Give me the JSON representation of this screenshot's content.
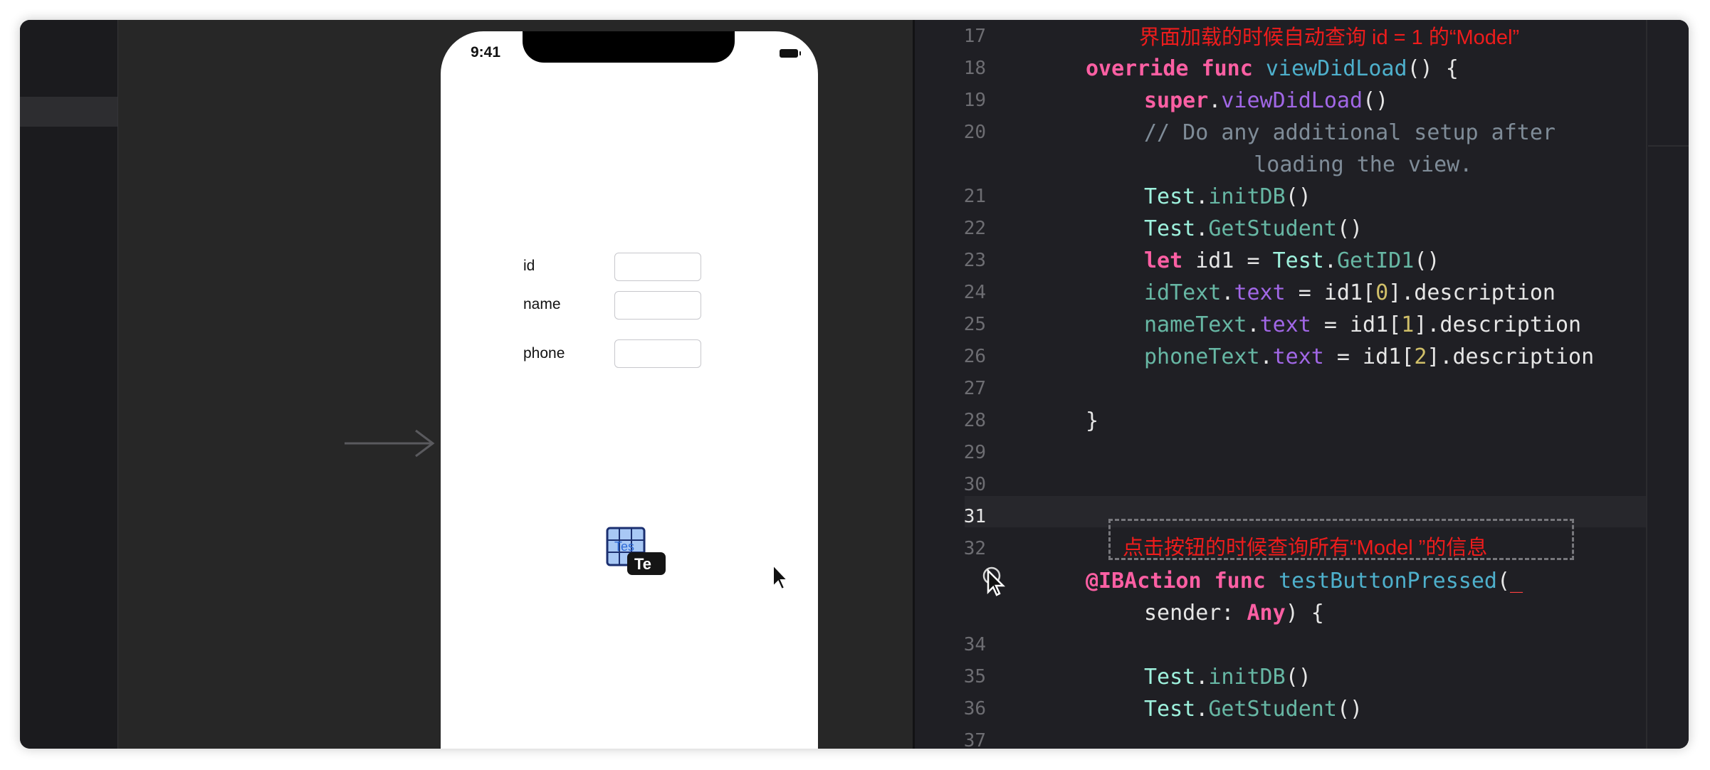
{
  "phone": {
    "status_time": "9:41",
    "fields": [
      {
        "label": "id"
      },
      {
        "label": "name"
      },
      {
        "label": "phone"
      }
    ],
    "drag_ghost_label": "Te",
    "drag_ghost_icon_text": "Tes"
  },
  "editor": {
    "annotation_top": "界面加载的时候自动查询 id = 1 的“Model”",
    "annotation_bottom": "点击按钮的时候查询所有“Model ”的信息",
    "lines": [
      {
        "n": "17",
        "tokens": []
      },
      {
        "n": "18",
        "tokens": [
          {
            "t": "override",
            "c": "kw"
          },
          {
            "t": " "
          },
          {
            "t": "func",
            "c": "kw"
          },
          {
            "t": " "
          },
          {
            "t": "viewDidLoad",
            "c": "fn"
          },
          {
            "t": "() {"
          }
        ]
      },
      {
        "n": "19",
        "tokens": [
          {
            "t": "super",
            "c": "kw"
          },
          {
            "t": "."
          },
          {
            "t": "viewDidLoad",
            "c": "prop"
          },
          {
            "t": "()"
          }
        ]
      },
      {
        "n": "20",
        "tokens": [
          {
            "t": "// Do any additional setup after",
            "c": "cmt"
          }
        ]
      },
      {
        "n": "",
        "tokens": [
          {
            "t": "    loading the view.",
            "c": "cmt"
          }
        ]
      },
      {
        "n": "21",
        "tokens": [
          {
            "t": "Test",
            "c": "cls"
          },
          {
            "t": "."
          },
          {
            "t": "initDB",
            "c": "call"
          },
          {
            "t": "()"
          }
        ]
      },
      {
        "n": "22",
        "tokens": [
          {
            "t": "Test",
            "c": "cls"
          },
          {
            "t": "."
          },
          {
            "t": "GetStudent",
            "c": "call"
          },
          {
            "t": "()"
          }
        ]
      },
      {
        "n": "23",
        "tokens": [
          {
            "t": "let",
            "c": "kw"
          },
          {
            "t": " id1 = "
          },
          {
            "t": "Test",
            "c": "cls"
          },
          {
            "t": "."
          },
          {
            "t": "GetID1",
            "c": "call"
          },
          {
            "t": "()"
          }
        ]
      },
      {
        "n": "24",
        "tokens": [
          {
            "t": "idText",
            "c": "call"
          },
          {
            "t": "."
          },
          {
            "t": "text",
            "c": "prop"
          },
          {
            "t": " = id1["
          },
          {
            "t": "0",
            "c": "num"
          },
          {
            "t": "].description"
          }
        ]
      },
      {
        "n": "25",
        "tokens": [
          {
            "t": "nameText",
            "c": "call"
          },
          {
            "t": "."
          },
          {
            "t": "text",
            "c": "prop"
          },
          {
            "t": " = id1["
          },
          {
            "t": "1",
            "c": "num"
          },
          {
            "t": "].description"
          }
        ]
      },
      {
        "n": "26",
        "tokens": [
          {
            "t": "phoneText",
            "c": "call"
          },
          {
            "t": "."
          },
          {
            "t": "text",
            "c": "prop"
          },
          {
            "t": " = id1["
          },
          {
            "t": "2",
            "c": "num"
          },
          {
            "t": "].description"
          }
        ]
      },
      {
        "n": "27",
        "tokens": []
      },
      {
        "n": "28",
        "tokens": [
          {
            "t": "}"
          }
        ]
      },
      {
        "n": "29",
        "tokens": []
      },
      {
        "n": "30",
        "tokens": []
      },
      {
        "n": "31",
        "tokens": [],
        "current": true
      },
      {
        "n": "32",
        "tokens": []
      },
      {
        "n": "",
        "tokens": [
          {
            "t": "@IBAction",
            "c": "kw"
          },
          {
            "t": " "
          },
          {
            "t": "func",
            "c": "kw"
          },
          {
            "t": " "
          },
          {
            "t": "testButtonPressed",
            "c": "fn"
          },
          {
            "t": "("
          },
          {
            "t": "_",
            "c": "cursor"
          }
        ]
      },
      {
        "n": "",
        "tokens": [
          {
            "t": "sender: "
          },
          {
            "t": "Any",
            "c": "kw"
          },
          {
            "t": ") {"
          }
        ]
      },
      {
        "n": "34",
        "tokens": []
      },
      {
        "n": "35",
        "tokens": [
          {
            "t": "Test",
            "c": "cls"
          },
          {
            "t": "."
          },
          {
            "t": "initDB",
            "c": "call"
          },
          {
            "t": "()"
          }
        ]
      },
      {
        "n": "36",
        "tokens": [
          {
            "t": "Test",
            "c": "cls"
          },
          {
            "t": "."
          },
          {
            "t": "GetStudent",
            "c": "call"
          },
          {
            "t": "()"
          }
        ]
      },
      {
        "n": "37",
        "tokens": []
      }
    ]
  }
}
